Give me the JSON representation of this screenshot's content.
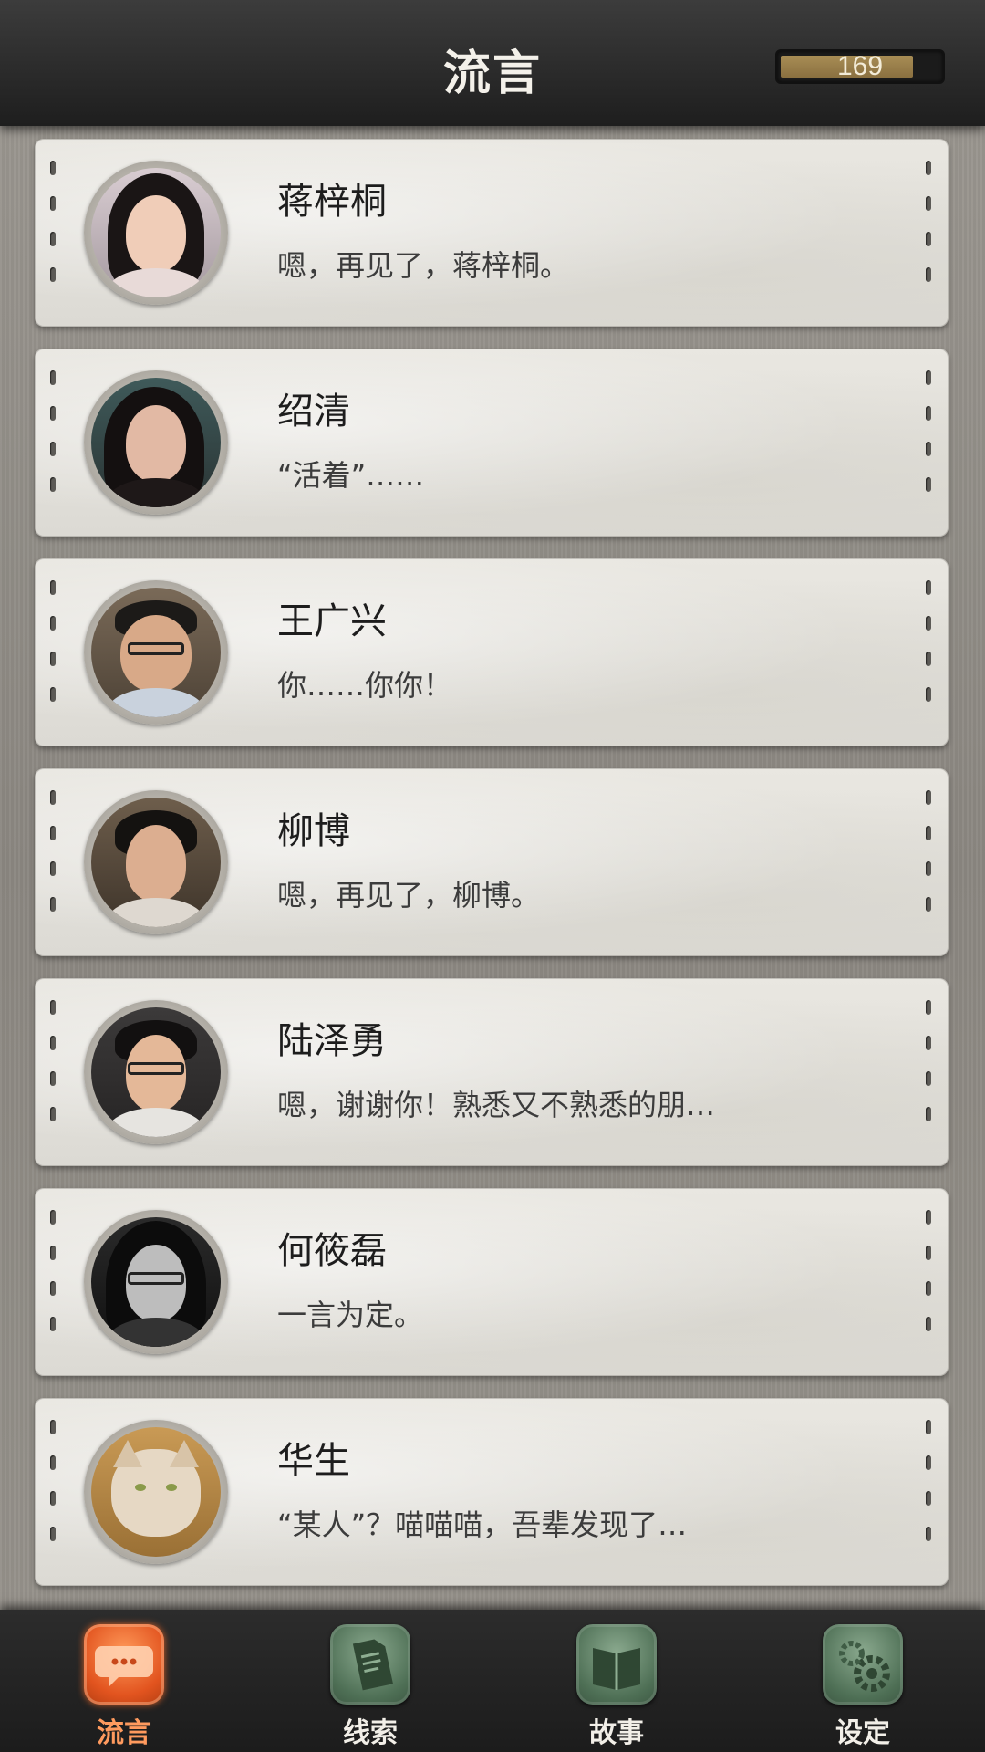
{
  "header": {
    "title": "流言",
    "counter": "169",
    "counter_level_percent": 85
  },
  "contacts": [
    {
      "name": "蒋梓桐",
      "message": "嗯，再见了，蒋梓桐。"
    },
    {
      "name": "绍清",
      "message": "“活着”……"
    },
    {
      "name": "王广兴",
      "message": "你……你你！"
    },
    {
      "name": "柳博",
      "message": "嗯，再见了，柳博。"
    },
    {
      "name": "陆泽勇",
      "message": "嗯，谢谢你！熟悉又不熟悉的朋…"
    },
    {
      "name": "何筱磊",
      "message": "一言为定。"
    },
    {
      "name": "华生",
      "message": "“某人”？喵喵喵，吾辈发现了…"
    }
  ],
  "nav": {
    "items": [
      {
        "label": "流言",
        "icon": "chat-bubble-icon",
        "active": true
      },
      {
        "label": "线索",
        "icon": "document-icon",
        "active": false
      },
      {
        "label": "故事",
        "icon": "book-icon",
        "active": false
      },
      {
        "label": "设定",
        "icon": "gear-icon",
        "active": false
      }
    ]
  },
  "colors": {
    "active_tab": "#e2541f",
    "inactive_tab": "#4e6f55",
    "header_bg": "#2a2a2a",
    "card_bg": "#e4e2dc"
  }
}
